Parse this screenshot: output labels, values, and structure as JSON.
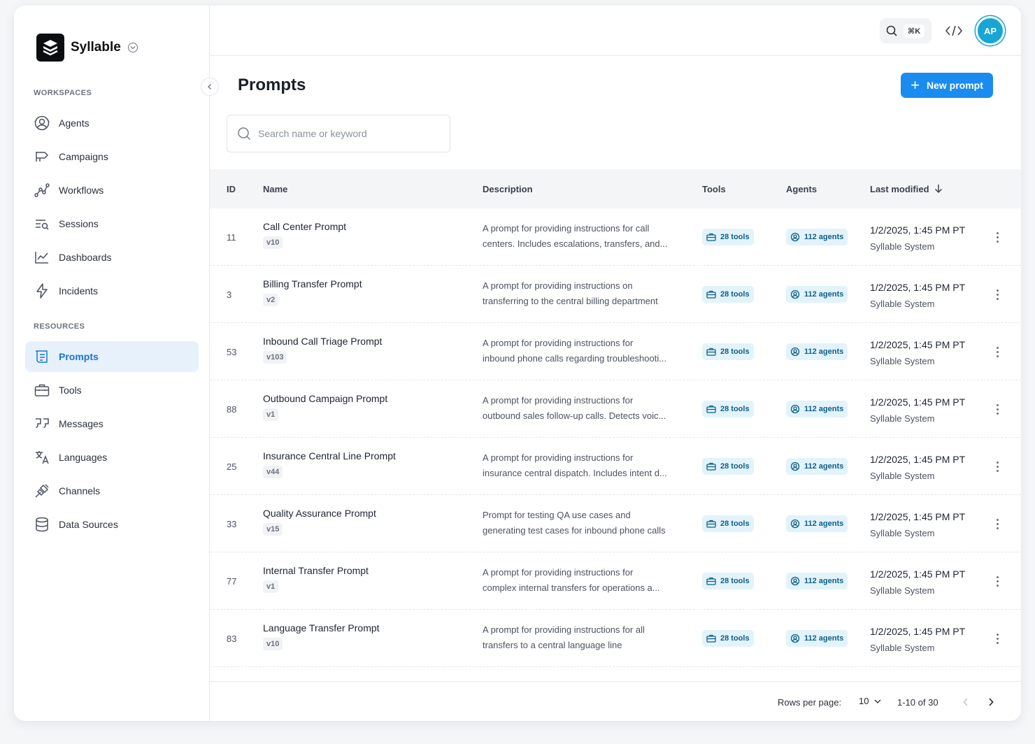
{
  "brand": {
    "name": "Syllable"
  },
  "sidebar": {
    "workspaces_label": "WORKSPACES",
    "resources_label": "RESOURCES",
    "workspaces": [
      {
        "label": "Agents",
        "icon": "agents-icon"
      },
      {
        "label": "Campaigns",
        "icon": "megaphone-icon"
      },
      {
        "label": "Workflows",
        "icon": "workflow-icon"
      },
      {
        "label": "Sessions",
        "icon": "sessions-icon"
      },
      {
        "label": "Dashboards",
        "icon": "chart-icon"
      },
      {
        "label": "Incidents",
        "icon": "bolt-icon"
      }
    ],
    "resources": [
      {
        "label": "Prompts",
        "icon": "prompt-icon",
        "active": true
      },
      {
        "label": "Tools",
        "icon": "toolbox-icon"
      },
      {
        "label": "Messages",
        "icon": "quote-icon"
      },
      {
        "label": "Languages",
        "icon": "translate-icon"
      },
      {
        "label": "Channels",
        "icon": "plug-icon"
      },
      {
        "label": "Data Sources",
        "icon": "database-icon"
      }
    ]
  },
  "topbar": {
    "shortcut": "⌘K",
    "avatar_initials": "AP"
  },
  "page": {
    "title": "Prompts",
    "new_button": "New prompt",
    "search_placeholder": "Search name or keyword"
  },
  "table": {
    "headers": {
      "id": "ID",
      "name": "Name",
      "description": "Description",
      "tools": "Tools",
      "agents": "Agents",
      "modified": "Last modified"
    },
    "rows": [
      {
        "id": "11",
        "name": "Call Center Prompt",
        "version": "v10",
        "desc1": "A prompt for providing instructions for call",
        "desc2": "centers. Includes escalations, transfers, and...",
        "tools": "28 tools",
        "agents": "112 agents",
        "date": "1/2/2025, 1:45 PM PT",
        "user": "Syllable System"
      },
      {
        "id": "3",
        "name": "Billing Transfer Prompt",
        "version": "v2",
        "desc1": "A prompt for providing instructions on",
        "desc2": "transferring to the central billing department",
        "tools": "28 tools",
        "agents": "112 agents",
        "date": "1/2/2025, 1:45 PM PT",
        "user": "Syllable System"
      },
      {
        "id": "53",
        "name": "Inbound Call Triage Prompt",
        "version": "v103",
        "desc1": "A prompt for providing instructions for",
        "desc2": "inbound phone calls regarding troubleshooti...",
        "tools": "28 tools",
        "agents": "112 agents",
        "date": "1/2/2025, 1:45 PM PT",
        "user": "Syllable System"
      },
      {
        "id": "88",
        "name": "Outbound Campaign Prompt",
        "version": "v1",
        "desc1": "A prompt for providing instructions for",
        "desc2": "outbound sales follow-up calls. Detects voic...",
        "tools": "28 tools",
        "agents": "112 agents",
        "date": "1/2/2025, 1:45 PM PT",
        "user": "Syllable System"
      },
      {
        "id": "25",
        "name": "Insurance Central Line Prompt",
        "version": "v44",
        "desc1": "A prompt for providing instructions for",
        "desc2": "insurance central dispatch. Includes intent d...",
        "tools": "28 tools",
        "agents": "112 agents",
        "date": "1/2/2025, 1:45 PM PT",
        "user": "Syllable System"
      },
      {
        "id": "33",
        "name": "Quality Assurance Prompt",
        "version": "v15",
        "desc1": "Prompt for testing QA use cases and",
        "desc2": "generating test cases for inbound phone calls",
        "tools": "28 tools",
        "agents": "112 agents",
        "date": "1/2/2025, 1:45 PM PT",
        "user": "Syllable System"
      },
      {
        "id": "77",
        "name": "Internal Transfer Prompt",
        "version": "v1",
        "desc1": "A prompt for providing instructions for",
        "desc2": "complex internal transfers for operations a...",
        "tools": "28 tools",
        "agents": "112 agents",
        "date": "1/2/2025, 1:45 PM PT",
        "user": "Syllable System"
      },
      {
        "id": "83",
        "name": "Language Transfer Prompt",
        "version": "v10",
        "desc1": "A prompt for providing instructions for all",
        "desc2": "transfers to a central language line",
        "tools": "28 tools",
        "agents": "112 agents",
        "date": "1/2/2025, 1:45 PM PT",
        "user": "Syllable System"
      }
    ]
  },
  "pagination": {
    "rows_label": "Rows per page:",
    "rows_value": "10",
    "range": "1-10 of 30"
  },
  "colors": {
    "accent": "#1a8cf0",
    "active_bg": "#e6f1fc",
    "tag_bg": "#e2f3fb",
    "tag_text": "#0d5f86",
    "avatar": "#17a6d6"
  }
}
